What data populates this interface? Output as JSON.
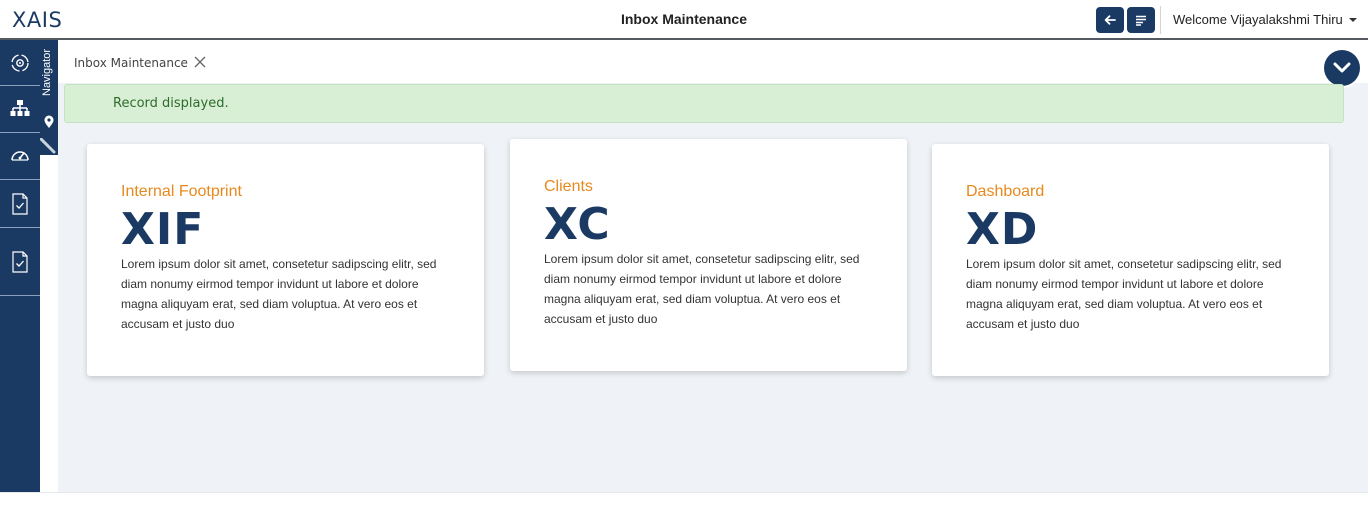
{
  "header": {
    "logo": "XAIS",
    "title": "Inbox Maintenance",
    "welcome": "Welcome Vijayalakshmi Thiru",
    "back_icon": "arrow-left-icon",
    "menu_icon": "menu-lines-icon"
  },
  "sidebar": {
    "items": [
      {
        "icon": "settings-cycle-icon"
      },
      {
        "icon": "hierarchy-icon"
      },
      {
        "icon": "speedometer-icon"
      },
      {
        "icon": "document-check-icon"
      },
      {
        "icon": "document-check-icon"
      }
    ],
    "navigator_label": "Navigator"
  },
  "tab": {
    "label": "Inbox Maintenance"
  },
  "alert": {
    "message": "Record displayed."
  },
  "cards": [
    {
      "title": "Internal Footprint",
      "abbr": "XIF",
      "description": "Lorem ipsum dolor sit amet, consetetur sadipscing elitr, sed diam nonumy eirmod tempor invidunt ut labore et dolore magna aliquyam erat, sed diam voluptua. At vero eos et accusam et justo duo"
    },
    {
      "title": "Clients",
      "abbr": "XC",
      "description": "Lorem ipsum dolor sit amet, consetetur sadipscing elitr, sed diam nonumy eirmod tempor invidunt ut labore et dolore magna aliquyam erat, sed diam voluptua. At vero eos et accusam et justo duo"
    },
    {
      "title": "Dashboard",
      "abbr": "XD",
      "description": "Lorem ipsum dolor sit amet, consetetur sadipscing elitr, sed diam nonumy eirmod tempor invidunt ut labore et dolore magna aliquyam erat, sed diam voluptua. At vero eos et accusam et justo duo"
    }
  ],
  "colors": {
    "brand": "#1b3a63",
    "accent": "#e8891e",
    "success_bg": "#d8efd6",
    "success_text": "#2e6b2a"
  }
}
